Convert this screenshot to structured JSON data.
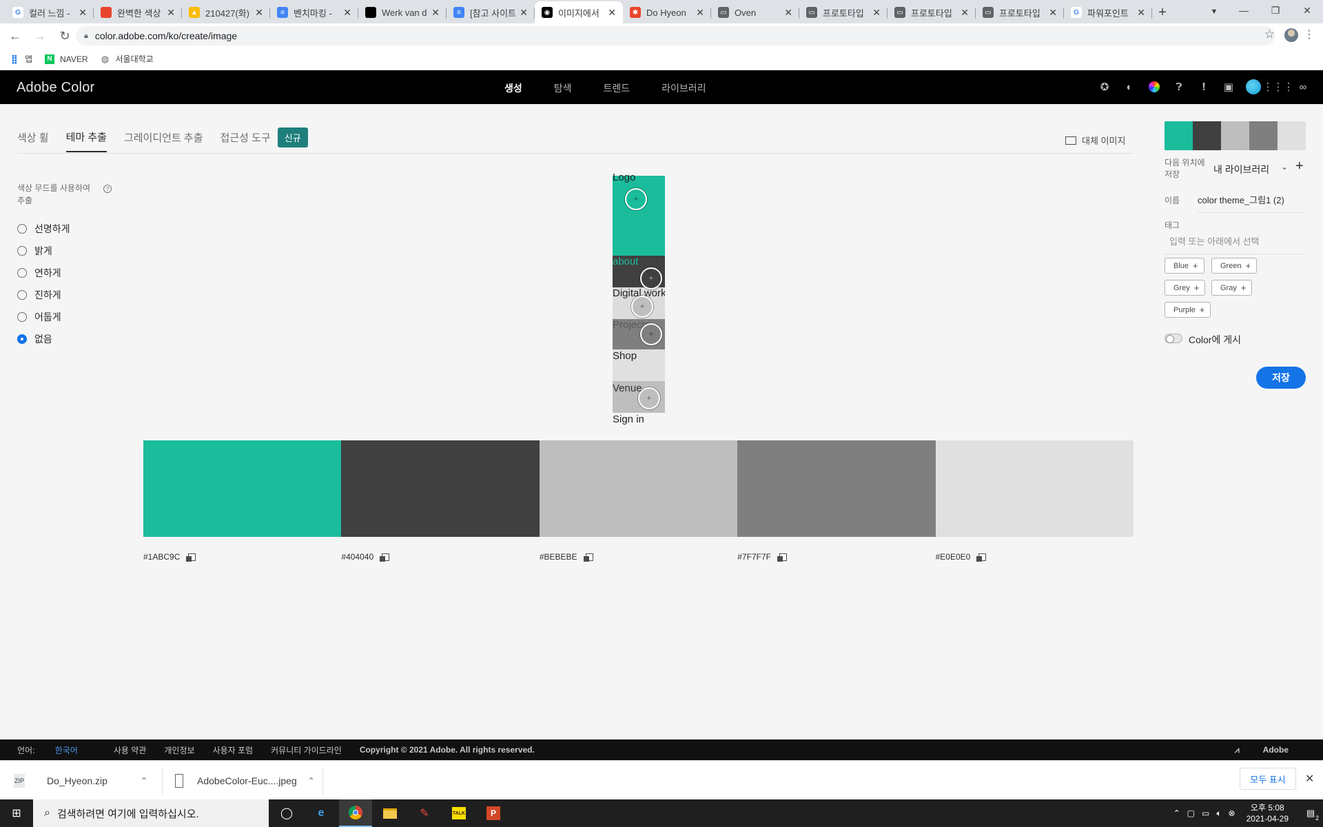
{
  "browser": {
    "tabs": [
      {
        "title": "컬러 느낌 - ",
        "fav_color": "#4285f4",
        "fav": "G"
      },
      {
        "title": "완벽한 색상",
        "fav_color": "#e8452c",
        "fav": ""
      },
      {
        "title": "210427(화)",
        "fav_color": "#fbbc04",
        "fav": "▲"
      },
      {
        "title": "벤치마킹 - ",
        "fav_color": "#4285f4",
        "fav": "≡"
      },
      {
        "title": "Werk van d",
        "fav_color": "#000000",
        "fav": ""
      },
      {
        "title": "[참고 사이트",
        "fav_color": "#4285f4",
        "fav": "≡"
      },
      {
        "title": "이미지에서",
        "fav_color": "#000000",
        "fav": "◉",
        "active": true
      },
      {
        "title": "Do Hyeon",
        "fav_color": "#e8452c",
        "fav": "✱"
      },
      {
        "title": "Oven",
        "fav_color": "#5f6368",
        "fav": "▭"
      },
      {
        "title": "프로토타입",
        "fav_color": "#5f6368",
        "fav": "▭"
      },
      {
        "title": "프로토타입",
        "fav_color": "#5f6368",
        "fav": "▭"
      },
      {
        "title": "프로토타입",
        "fav_color": "#5f6368",
        "fav": "▭"
      },
      {
        "title": "파워포인트",
        "fav_color": "#4285f4",
        "fav": "G"
      }
    ],
    "url": "color.adobe.com/ko/create/image",
    "bookmarks": [
      {
        "label": "앱",
        "icon": "apps-icon"
      },
      {
        "label": "NAVER",
        "icon": "naver-icon"
      },
      {
        "label": "서울대학교",
        "icon": "globe-icon"
      }
    ]
  },
  "header": {
    "brand": "Adobe Color",
    "nav": [
      "생성",
      "탐색",
      "트렌드",
      "라이브러리"
    ],
    "nav_active": 0,
    "icons": [
      "favorite-icon",
      "contrast-icon",
      "color-wheel-icon",
      "help-icon",
      "feedback-icon",
      "chat-icon",
      "avatar-icon",
      "apps-grid-icon",
      "creative-cloud-icon"
    ]
  },
  "subtabs": {
    "items": [
      "색상 휠",
      "테마 추출",
      "그레이디언트 추출",
      "접근성 도구"
    ],
    "active": 1,
    "badge": "신규",
    "alt_image": "대체 이미지"
  },
  "mood": {
    "label": "색상 무드를 사용하여 추출",
    "options": [
      "선명하게",
      "밝게",
      "연하게",
      "진하게",
      "어둡게",
      "없음"
    ],
    "selected": 5
  },
  "preview": {
    "texts": [
      "Logo",
      "about",
      "Digital work",
      "Projects",
      "Shop",
      "Venue",
      "Sign in"
    ]
  },
  "swatches": [
    {
      "hex": "#1ABC9C"
    },
    {
      "hex": "#404040"
    },
    {
      "hex": "#BEBEBE"
    },
    {
      "hex": "#7F7F7F"
    },
    {
      "hex": "#E0E0E0"
    }
  ],
  "panel": {
    "save_to_label": "다음 위치에 저장",
    "library": "내 라이브러리",
    "name_label": "이름",
    "name_value": "color theme_그림1 (2)",
    "tag_label": "태그",
    "tag_placeholder": "입력 또는 아래에서 선택",
    "tags": [
      "Blue",
      "Green",
      "Grey",
      "Gray",
      "Purple"
    ],
    "publish_label": "Color에 게시",
    "save_button": "저장"
  },
  "footer": {
    "lang_label": "언어:",
    "lang_value": "한국어",
    "links": [
      "사용 약관",
      "개인정보",
      "사용자 포럼",
      "커뮤니티 가이드라인"
    ],
    "copyright": "Copyright © 2021 Adobe. All rights reserved.",
    "adobe": "Adobe"
  },
  "downloads": {
    "items": [
      {
        "name": "Do_Hyeon.zip",
        "icon": "zip-file-icon"
      },
      {
        "name": "AdobeColor-Euc....jpeg",
        "icon": "image-file-icon"
      }
    ],
    "show_all": "모두 표시"
  },
  "taskbar": {
    "search_placeholder": "검색하려면 여기에 입력하십시오.",
    "time": "오후 5:08",
    "date": "2021-04-29",
    "notification_count": "2"
  }
}
